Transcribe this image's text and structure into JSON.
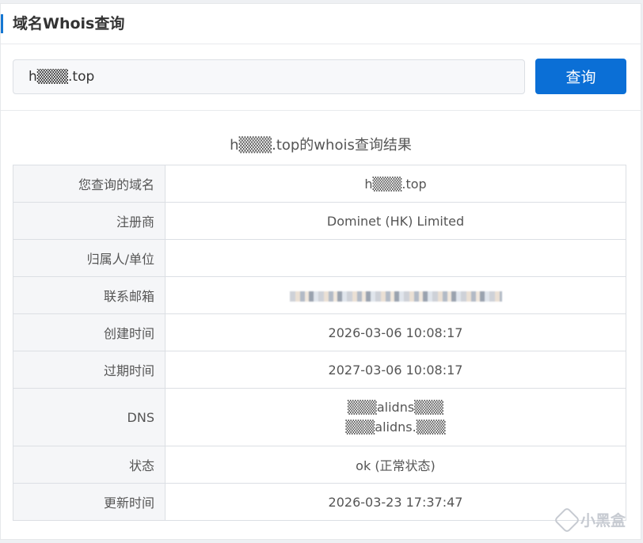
{
  "header": {
    "title": "域名Whois查询"
  },
  "search": {
    "value": "h▒▒▒.top",
    "button_label": "查询"
  },
  "result": {
    "title": "h▒▒▒.top的whois查询结果",
    "rows": [
      {
        "label": "您查询的域名",
        "value": "h▒▒▒.top"
      },
      {
        "label": "注册商",
        "value": "Dominet (HK) Limited"
      },
      {
        "label": "归属人/单位",
        "value": ""
      },
      {
        "label": "联系邮箱",
        "value": ""
      },
      {
        "label": "创建时间",
        "value": "2026-03-06 10:08:17"
      },
      {
        "label": "过期时间",
        "value": "2027-03-06 10:08:17"
      },
      {
        "label": "DNS",
        "value_lines": [
          "▒▒▒alidns▒▒▒",
          "▒▒▒alidns.▒▒▒"
        ]
      },
      {
        "label": "状态",
        "value": "ok (正常状态)"
      },
      {
        "label": "更新时间",
        "value": "2026-03-23 17:37:47"
      }
    ]
  },
  "watermark": {
    "text": "小黑盒"
  },
  "colors": {
    "accent": "#0b6fd6",
    "label_bg": "#f5f6f8",
    "border": "#dcdfe4"
  }
}
